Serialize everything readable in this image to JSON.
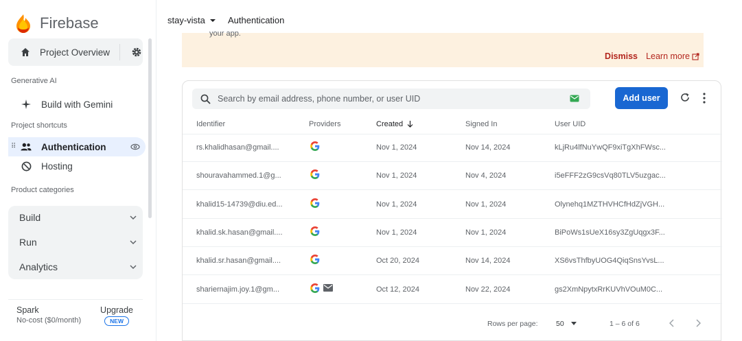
{
  "brand": {
    "name": "Firebase"
  },
  "sidebar": {
    "overview_label": "Project Overview",
    "section_generative": "Generative AI",
    "gemini_label": "Build with Gemini",
    "section_shortcuts": "Project shortcuts",
    "authentication_label": "Authentication",
    "hosting_label": "Hosting",
    "section_categories": "Product categories",
    "categories": [
      {
        "label": "Build"
      },
      {
        "label": "Run"
      },
      {
        "label": "Analytics"
      }
    ],
    "plan": {
      "name": "Spark",
      "cost": "No-cost ($0/month)",
      "upgrade": "Upgrade",
      "badge": "NEW"
    }
  },
  "topbar": {
    "project": "stay-vista",
    "page": "Authentication"
  },
  "banner": {
    "truncated_text": "your app.",
    "dismiss": "Dismiss",
    "learn_more": "Learn more"
  },
  "users": {
    "search_placeholder": "Search by email address, phone number, or user UID",
    "add_user": "Add user",
    "columns": [
      "Identifier",
      "Providers",
      "Created",
      "Signed In",
      "User UID"
    ],
    "rows": [
      {
        "identifier": "rs.khalidhasan@gmail....",
        "providers": [
          "google"
        ],
        "created": "Nov 1, 2024",
        "signed_in": "Nov 14, 2024",
        "uid": "kLjRu4lfNuYwQF9xiTgXhFWsc..."
      },
      {
        "identifier": "shouravahammed.1@g...",
        "providers": [
          "google"
        ],
        "created": "Nov 1, 2024",
        "signed_in": "Nov 4, 2024",
        "uid": "i5eFFF2zG9csVq80TLV5uzgac..."
      },
      {
        "identifier": "khalid15-14739@diu.ed...",
        "providers": [
          "google"
        ],
        "created": "Nov 1, 2024",
        "signed_in": "Nov 1, 2024",
        "uid": "Olynehq1MZTHVHCfHdZjVGH..."
      },
      {
        "identifier": "khalid.sk.hasan@gmail....",
        "providers": [
          "google"
        ],
        "created": "Nov 1, 2024",
        "signed_in": "Nov 1, 2024",
        "uid": "BiPoWs1sUeX16sy3ZgUqgx3F..."
      },
      {
        "identifier": "khalid.sr.hasan@gmail....",
        "providers": [
          "google"
        ],
        "created": "Oct 20, 2024",
        "signed_in": "Nov 14, 2024",
        "uid": "XS6vsThfbyUOG4QiqSnsYvsL..."
      },
      {
        "identifier": "shariernajim.joy.1@gm...",
        "providers": [
          "google",
          "email"
        ],
        "created": "Oct 12, 2024",
        "signed_in": "Nov 22, 2024",
        "uid": "gs2XmNpytxRrKUVhVOuM0C..."
      }
    ],
    "pagination": {
      "rows_per_page_label": "Rows per page:",
      "rows_per_page": "50",
      "range": "1 – 6 of 6"
    }
  },
  "colors": {
    "primary": "#1967d2",
    "banner_bg": "#fdf1e0",
    "banner_link": "#b3261e",
    "active_nav": "#e8f0fe"
  }
}
